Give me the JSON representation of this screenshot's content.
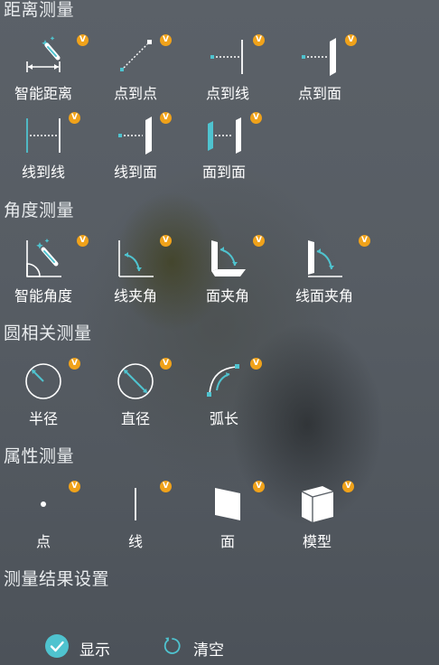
{
  "sections": {
    "distance": "距离测量",
    "angle": "角度测量",
    "circle": "圆相关测量",
    "attribute": "属性测量",
    "result": "测量结果设置"
  },
  "vip_badge": "V",
  "tools": {
    "smart_distance": "智能距离",
    "point_to_point": "点到点",
    "point_to_line": "点到线",
    "point_to_face": "点到面",
    "line_to_line": "线到线",
    "line_to_face": "线到面",
    "face_to_face": "面到面",
    "smart_angle": "智能角度",
    "line_angle": "线夹角",
    "face_angle": "面夹角",
    "line_face_angle": "线面夹角",
    "radius": "半径",
    "diameter": "直径",
    "arc_length": "弧长",
    "point": "点",
    "line": "线",
    "face": "面",
    "model": "模型"
  },
  "settings": {
    "show_label": "显示",
    "show_checked": true,
    "clear_label": "清空"
  },
  "colors": {
    "accent": "#4fc3cf",
    "vip": "#f0a21a"
  }
}
